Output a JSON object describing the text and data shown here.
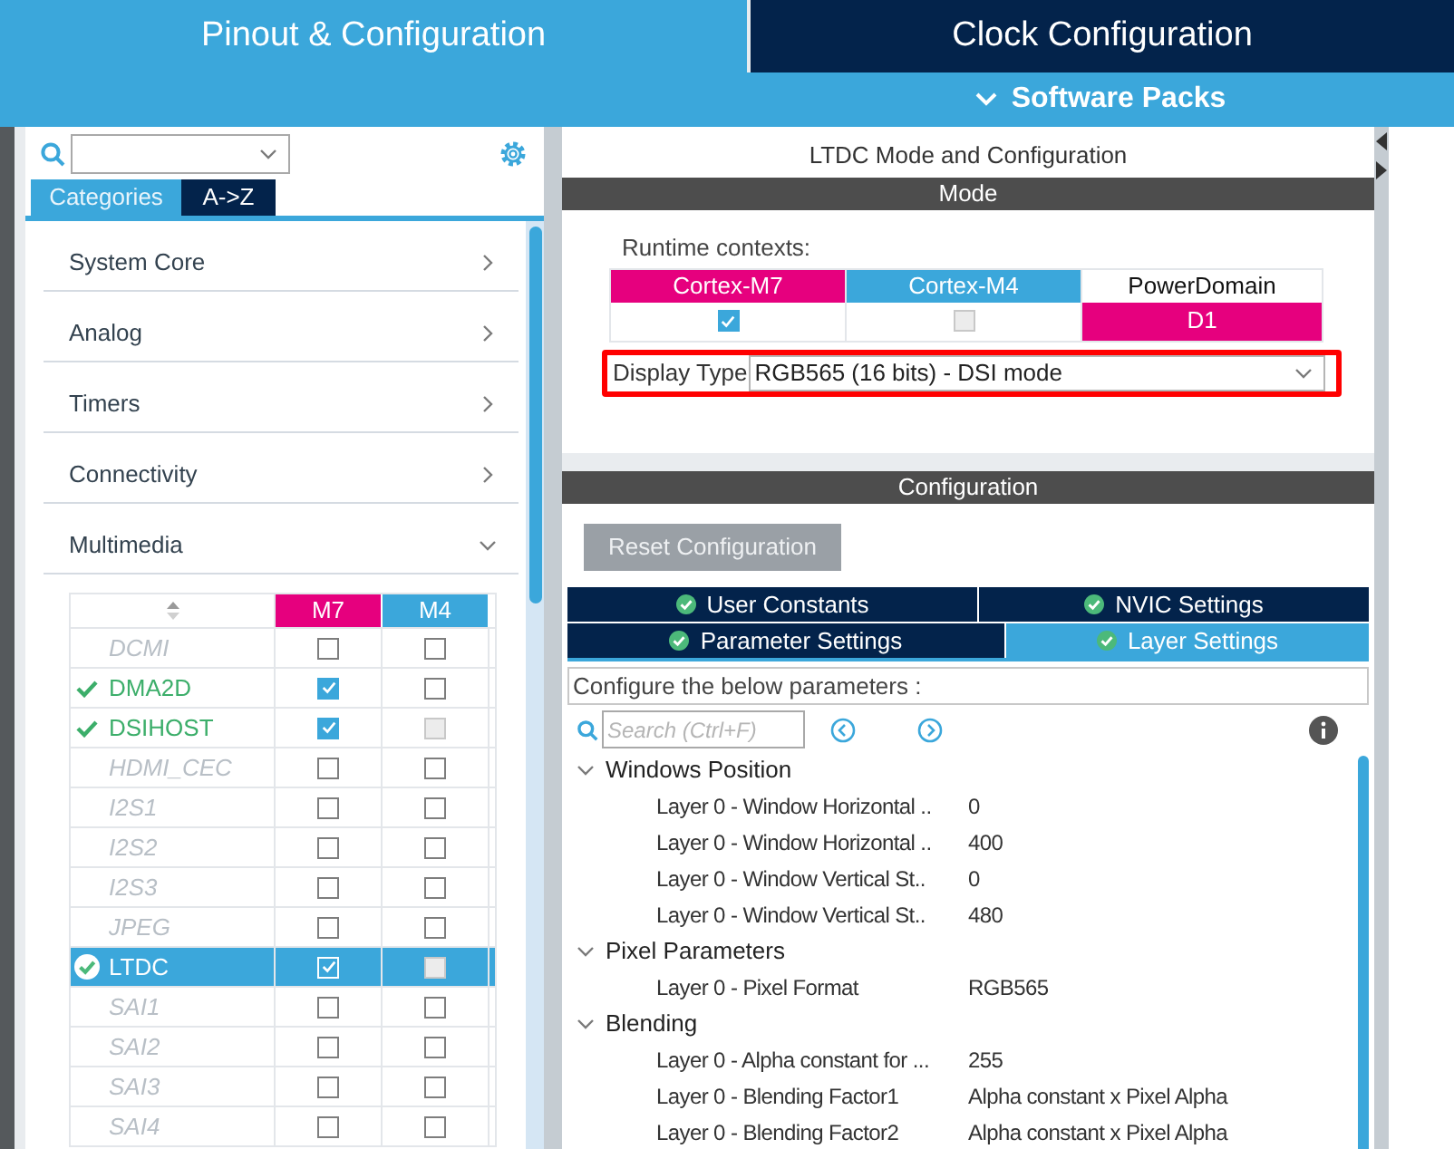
{
  "top_tabs": [
    {
      "label": "Pinout & Configuration",
      "selected": true
    },
    {
      "label": "Clock Configuration",
      "selected": false
    }
  ],
  "software_packs": {
    "label": "Software Packs"
  },
  "sidebar": {
    "view_tabs": [
      {
        "label": "Categories",
        "selected": true
      },
      {
        "label": "A->Z",
        "selected": false
      }
    ],
    "categories": [
      {
        "label": "System Core",
        "expanded": false
      },
      {
        "label": "Analog",
        "expanded": false
      },
      {
        "label": "Timers",
        "expanded": false
      },
      {
        "label": "Connectivity",
        "expanded": false
      },
      {
        "label": "Multimedia",
        "expanded": true
      }
    ],
    "table": {
      "columns": [
        "M7",
        "M4"
      ],
      "rows": [
        {
          "name": "DCMI",
          "configured": false,
          "selected": false,
          "m7": {
            "checked": false,
            "disabled": false
          },
          "m4": {
            "checked": false,
            "disabled": false
          }
        },
        {
          "name": "DMA2D",
          "configured": true,
          "selected": false,
          "m7": {
            "checked": true,
            "disabled": false
          },
          "m4": {
            "checked": false,
            "disabled": false
          }
        },
        {
          "name": "DSIHOST",
          "configured": true,
          "selected": false,
          "m7": {
            "checked": true,
            "disabled": false
          },
          "m4": {
            "checked": false,
            "disabled": true
          }
        },
        {
          "name": "HDMI_CEC",
          "configured": false,
          "selected": false,
          "m7": {
            "checked": false,
            "disabled": false
          },
          "m4": {
            "checked": false,
            "disabled": false
          }
        },
        {
          "name": "I2S1",
          "configured": false,
          "selected": false,
          "m7": {
            "checked": false,
            "disabled": false
          },
          "m4": {
            "checked": false,
            "disabled": false
          }
        },
        {
          "name": "I2S2",
          "configured": false,
          "selected": false,
          "m7": {
            "checked": false,
            "disabled": false
          },
          "m4": {
            "checked": false,
            "disabled": false
          }
        },
        {
          "name": "I2S3",
          "configured": false,
          "selected": false,
          "m7": {
            "checked": false,
            "disabled": false
          },
          "m4": {
            "checked": false,
            "disabled": false
          }
        },
        {
          "name": "JPEG",
          "configured": false,
          "selected": false,
          "m7": {
            "checked": false,
            "disabled": false
          },
          "m4": {
            "checked": false,
            "disabled": false
          }
        },
        {
          "name": "LTDC",
          "configured": true,
          "selected": true,
          "m7": {
            "checked": true,
            "disabled": false
          },
          "m4": {
            "checked": false,
            "disabled": true
          }
        },
        {
          "name": "SAI1",
          "configured": false,
          "selected": false,
          "m7": {
            "checked": false,
            "disabled": false
          },
          "m4": {
            "checked": false,
            "disabled": false
          }
        },
        {
          "name": "SAI2",
          "configured": false,
          "selected": false,
          "m7": {
            "checked": false,
            "disabled": false
          },
          "m4": {
            "checked": false,
            "disabled": false
          }
        },
        {
          "name": "SAI3",
          "configured": false,
          "selected": false,
          "m7": {
            "checked": false,
            "disabled": false
          },
          "m4": {
            "checked": false,
            "disabled": false
          }
        },
        {
          "name": "SAI4",
          "configured": false,
          "selected": false,
          "m7": {
            "checked": false,
            "disabled": false
          },
          "m4": {
            "checked": false,
            "disabled": false
          }
        }
      ]
    }
  },
  "panel": {
    "title": "LTDC Mode and Configuration",
    "mode": {
      "header": "Mode",
      "runtime_label": "Runtime contexts:",
      "contexts": [
        {
          "label": "Cortex-M7",
          "color": "#e6007e",
          "checked": true,
          "disabled": false
        },
        {
          "label": "Cortex-M4",
          "color": "#3ba7db",
          "checked": false,
          "disabled": true
        }
      ],
      "power_domain": {
        "label": "PowerDomain",
        "value": "D1"
      },
      "display_type": {
        "label": "Display Type",
        "value": "RGB565 (16 bits) - DSI mode",
        "highlighted": true
      }
    },
    "configuration": {
      "header": "Configuration",
      "reset_button": "Reset Configuration",
      "tab_rows": [
        [
          {
            "label": "User Constants",
            "selected": false
          },
          {
            "label": "NVIC Settings",
            "selected": false
          }
        ],
        [
          {
            "label": "Parameter Settings",
            "selected": false
          },
          {
            "label": "Layer Settings",
            "selected": true
          }
        ]
      ],
      "hint": "Configure the below parameters :",
      "search": {
        "placeholder": "Search (Ctrl+F)"
      },
      "groups": [
        {
          "label": "Windows Position",
          "expanded": true,
          "children": [
            {
              "label": "Layer 0 - Window Horizontal ..",
              "value": "0"
            },
            {
              "label": "Layer 0 - Window Horizontal ..",
              "value": "400"
            },
            {
              "label": "Layer 0 - Window Vertical St..",
              "value": "0"
            },
            {
              "label": "Layer 0 - Window Vertical St..",
              "value": "480"
            }
          ]
        },
        {
          "label": "Pixel Parameters",
          "expanded": true,
          "children": [
            {
              "label": "Layer 0 - Pixel Format",
              "value": "RGB565"
            }
          ]
        },
        {
          "label": "Blending",
          "expanded": true,
          "children": [
            {
              "label": "Layer 0 - Alpha constant for ...",
              "value": "255"
            },
            {
              "label": "Layer 0 - Blending Factor1",
              "value": "Alpha constant x Pixel Alpha"
            },
            {
              "label": "Layer 0 - Blending Factor2",
              "value": "Alpha constant x Pixel Alpha"
            }
          ]
        }
      ]
    }
  }
}
